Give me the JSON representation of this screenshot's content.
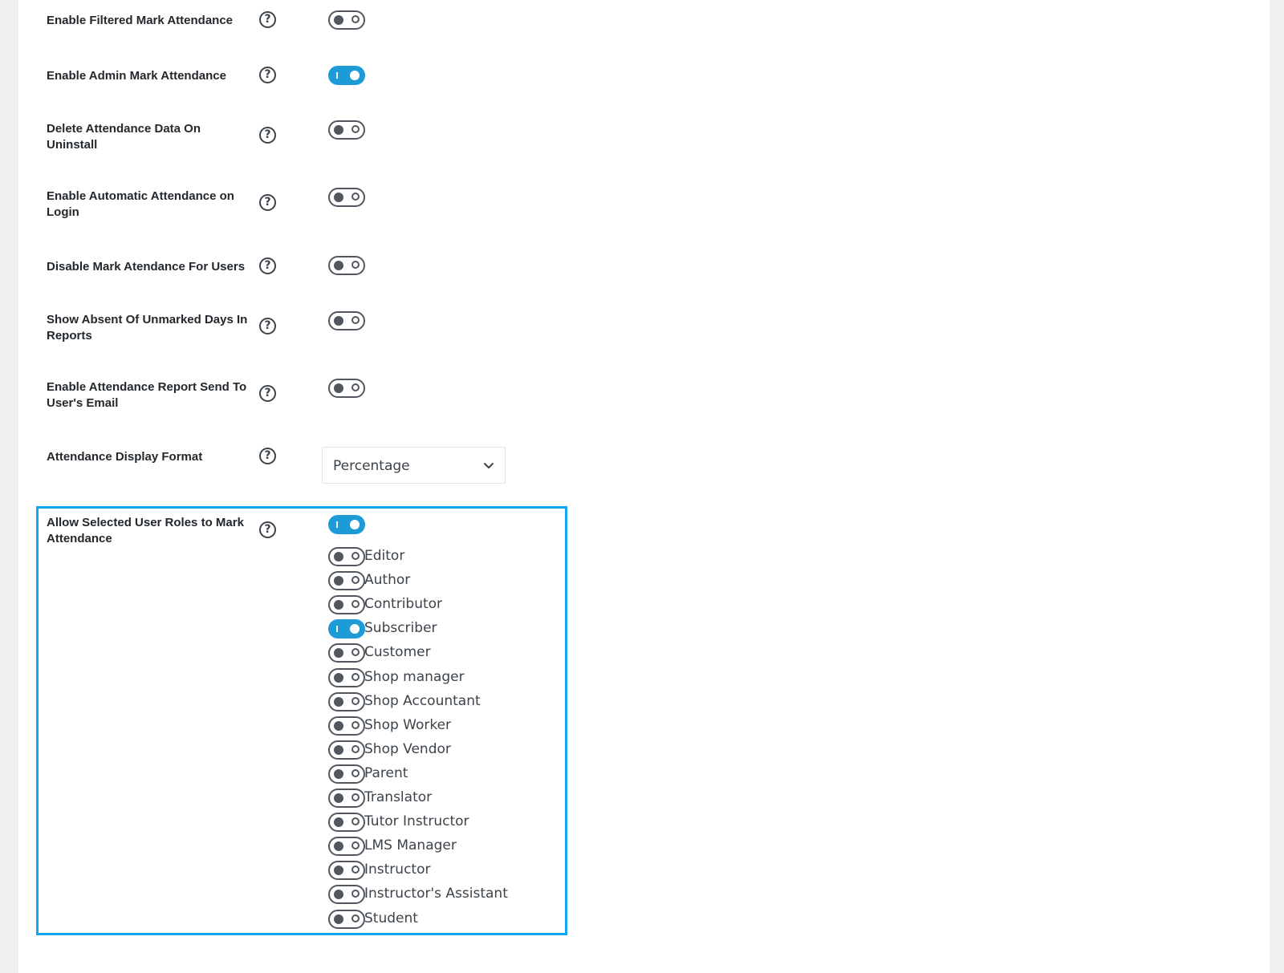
{
  "settings": [
    {
      "label": "Enable Filtered Mark Attendance",
      "enabled": false
    },
    {
      "label": "Enable Admin Mark Attendance",
      "enabled": true
    },
    {
      "label": "Delete Attendance Data On Uninstall",
      "enabled": false
    },
    {
      "label": "Enable Automatic Attendance on Login",
      "enabled": false
    },
    {
      "label": "Disable Mark Atendance For Users",
      "enabled": false
    },
    {
      "label": "Show Absent Of Unmarked Days In Reports",
      "enabled": false
    },
    {
      "label": "Enable Attendance Report Send To User's Email",
      "enabled": false
    }
  ],
  "display_format": {
    "label": "Attendance Display Format",
    "selected": "Percentage"
  },
  "roles_section": {
    "label": "Allow Selected User Roles to Mark Attendance",
    "enabled": true,
    "roles": [
      {
        "name": "Editor",
        "enabled": false
      },
      {
        "name": "Author",
        "enabled": false
      },
      {
        "name": "Contributor",
        "enabled": false
      },
      {
        "name": "Subscriber",
        "enabled": true
      },
      {
        "name": "Customer",
        "enabled": false
      },
      {
        "name": "Shop manager",
        "enabled": false
      },
      {
        "name": "Shop Accountant",
        "enabled": false
      },
      {
        "name": "Shop Worker",
        "enabled": false
      },
      {
        "name": "Shop Vendor",
        "enabled": false
      },
      {
        "name": "Parent",
        "enabled": false
      },
      {
        "name": "Translator",
        "enabled": false
      },
      {
        "name": "Tutor Instructor",
        "enabled": false
      },
      {
        "name": "LMS Manager",
        "enabled": false
      },
      {
        "name": "Instructor",
        "enabled": false
      },
      {
        "name": "Instructor's Assistant",
        "enabled": false
      },
      {
        "name": "Student",
        "enabled": false
      }
    ]
  },
  "help_glyph": "?",
  "colors": {
    "toggle_on": "#1d9bd7",
    "highlight_border": "#13a3f0"
  }
}
